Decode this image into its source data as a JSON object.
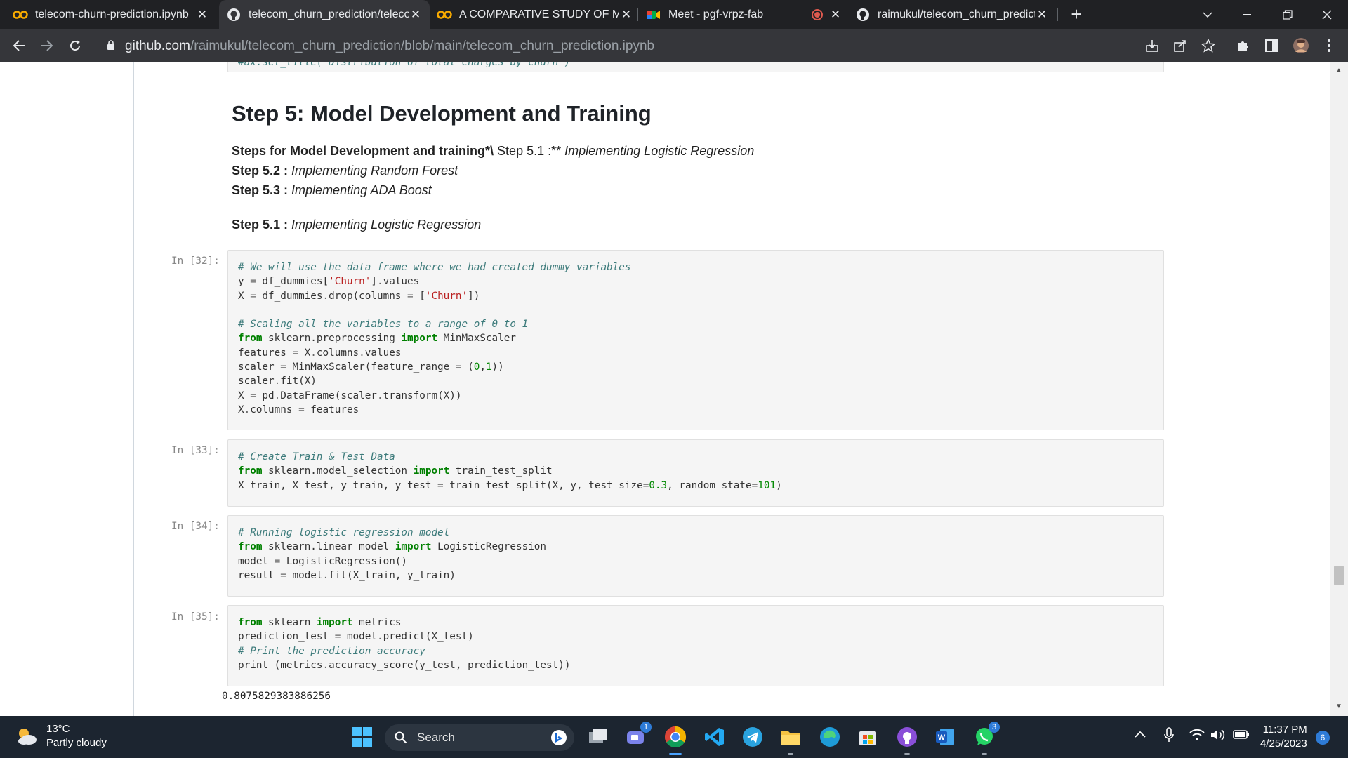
{
  "browser": {
    "tabs": [
      {
        "title": "telecom-churn-prediction.ipynb",
        "icon": "colab-icon",
        "active": false
      },
      {
        "title": "telecom_churn_prediction/telecom",
        "icon": "github-icon",
        "active": true
      },
      {
        "title": "A COMPARATIVE STUDY OF MUL",
        "icon": "colab-icon",
        "active": false
      },
      {
        "title": "Meet - pgf-vrpz-fab",
        "icon": "meet-icon",
        "active": false
      },
      {
        "title": "raimukul/telecom_churn_predicti",
        "icon": "github-icon",
        "active": false
      }
    ],
    "url_host": "github.com",
    "url_path": "/raimukul/telecom_churn_prediction/blob/main/telecom_churn_prediction.ipynb",
    "recording_indicator_color": "#e05a4f"
  },
  "notebook": {
    "clipped_top_line": "#ax.set_title('Distribution of total charges by churn')",
    "heading": "Step 5: Model Development and Training",
    "steps_intro_bold": "Steps for Model Development and training*\\",
    "steps_intro_rest": " Step 5.1 :** ",
    "steps_intro_italic": "Implementing Logistic Regression",
    "step52_label": "Step 5.2 :",
    "step52_text": "Implementing Random Forest",
    "step53_label": "Step 5.3 :",
    "step53_text": "Implementing ADA Boost",
    "step51_label": "Step 5.1 :",
    "step51_text": "Implementing Logistic Regression",
    "cells": [
      {
        "prompt": "In [32]:"
      },
      {
        "prompt": "In [33]:"
      },
      {
        "prompt": "In [34]:"
      },
      {
        "prompt": "In [35]:"
      }
    ],
    "output_35": "0.8075829383886256"
  },
  "taskbar": {
    "temperature": "13°C",
    "weather": "Partly cloudy",
    "search_label": "Search",
    "time": "11:37 PM",
    "date": "4/25/2023",
    "notification_count": "6",
    "teams_badge": "1",
    "whatsapp_badge": "3"
  },
  "colors": {
    "tabbar": "#202124",
    "toolbar": "#35363a",
    "code_bg": "#f5f5f5",
    "code_comment": "#3d7b7b",
    "code_keyword": "#008000",
    "code_string": "#ba2121",
    "taskbar": "#1c2530",
    "accent": "#2e7bd6"
  }
}
